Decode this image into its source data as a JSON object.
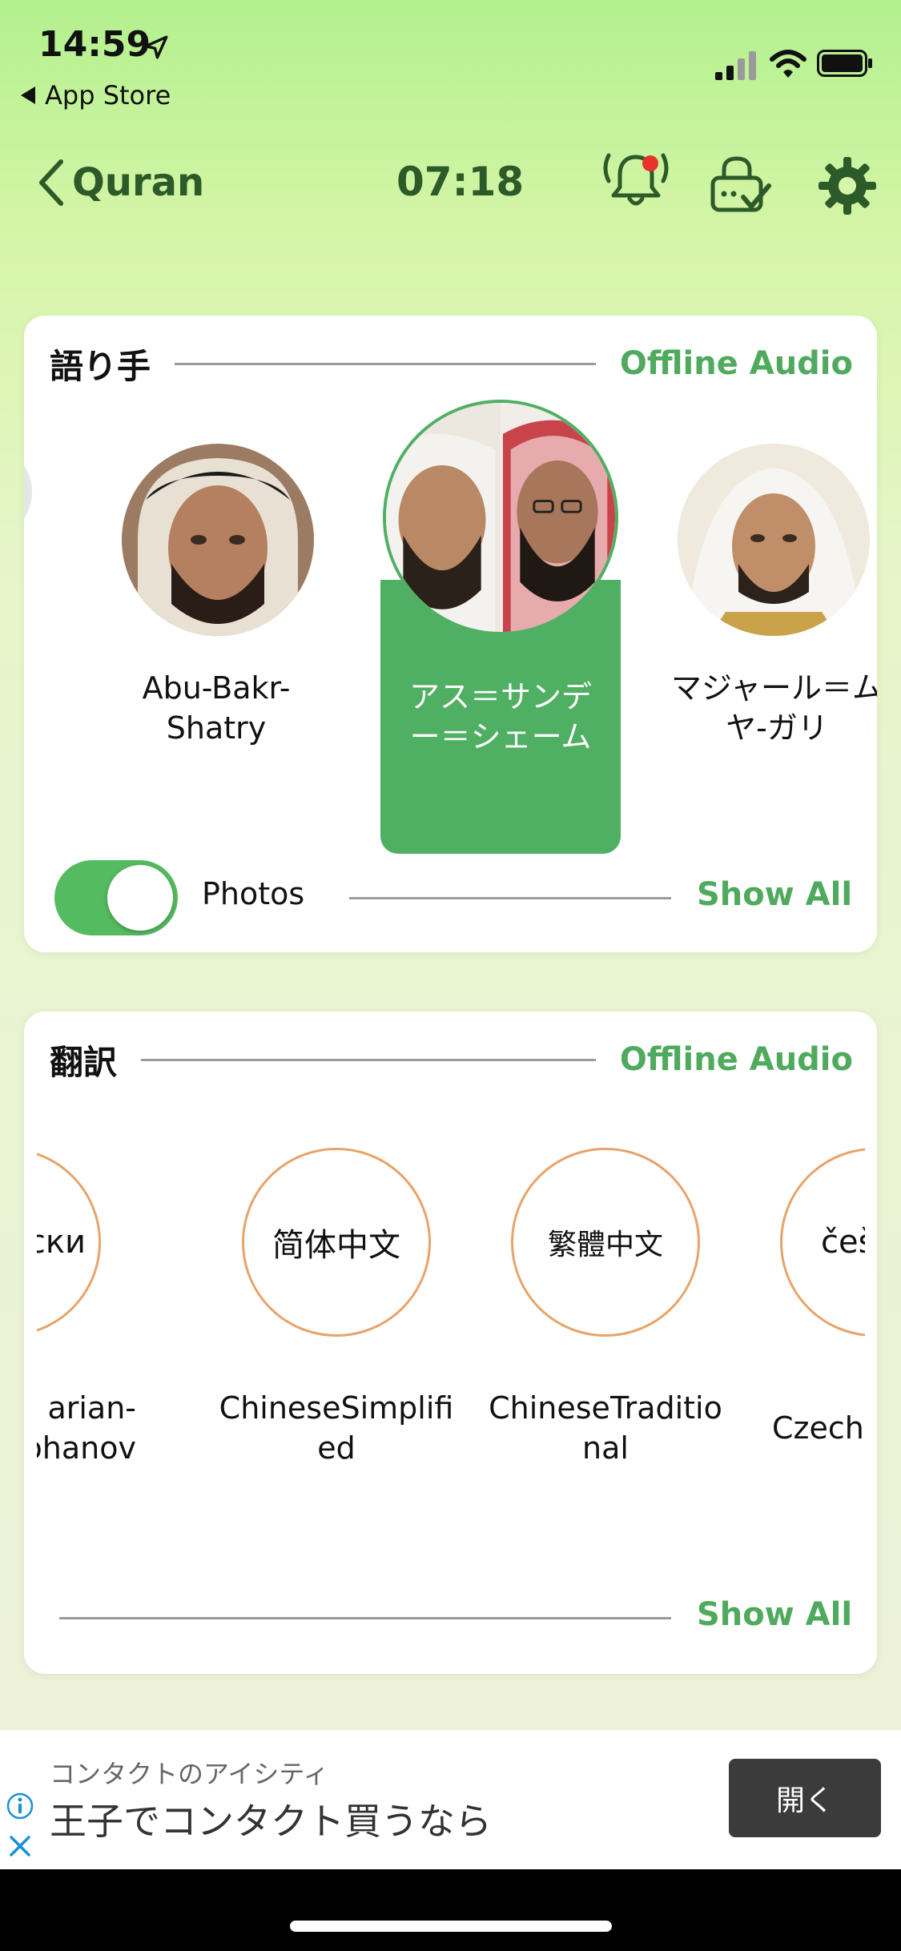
{
  "status_bar": {
    "time": "14:59",
    "back_app": "App Store"
  },
  "nav": {
    "back_label": "Quran",
    "timer": "07:18",
    "icons": [
      "bell-icon",
      "lock-check-icon",
      "gear-icon"
    ],
    "accent_color": "#2c5a28"
  },
  "reciters_card": {
    "title": "語り手",
    "offline_label": "Offline Audio",
    "reciters": [
      {
        "name": "Abu-Bakr-Shatry",
        "line1": "Abu-Bakr-",
        "line2": "Shatry"
      },
      {
        "name": "アス＝サンデー＝シェーム",
        "line1": "アス＝サンデ",
        "line2": "ー＝シェーム",
        "selected": true
      },
      {
        "name": "マジャール＝ムヤ-ガリ",
        "line1": "マジャール＝ム",
        "line2": "ヤ-ガリ"
      }
    ],
    "photos_label": "Photos",
    "photos_enabled": true,
    "show_all": "Show All"
  },
  "translations_card": {
    "title": "翻訳",
    "offline_label": "Offline Audio",
    "languages": [
      {
        "native": "арски",
        "line1": "arian-",
        "line2": "ohanov"
      },
      {
        "native": "简体中文",
        "line1": "ChineseSimplifi",
        "line2": "ed"
      },
      {
        "native": "繁體中文",
        "line1": "ChineseTraditio",
        "line2": "nal"
      },
      {
        "native": "češt",
        "line1": "Czech-",
        "line2": ""
      }
    ],
    "show_all": "Show All"
  },
  "ad": {
    "subtitle": "コンタクトのアイシティ",
    "title": "王子でコンタクト買うなら",
    "button": "開く"
  },
  "colors": {
    "accent_green": "#4faa5e",
    "selected_bg": "#4faf63",
    "language_ring": "#e7a46a",
    "notification_dot": "#e8322c"
  }
}
